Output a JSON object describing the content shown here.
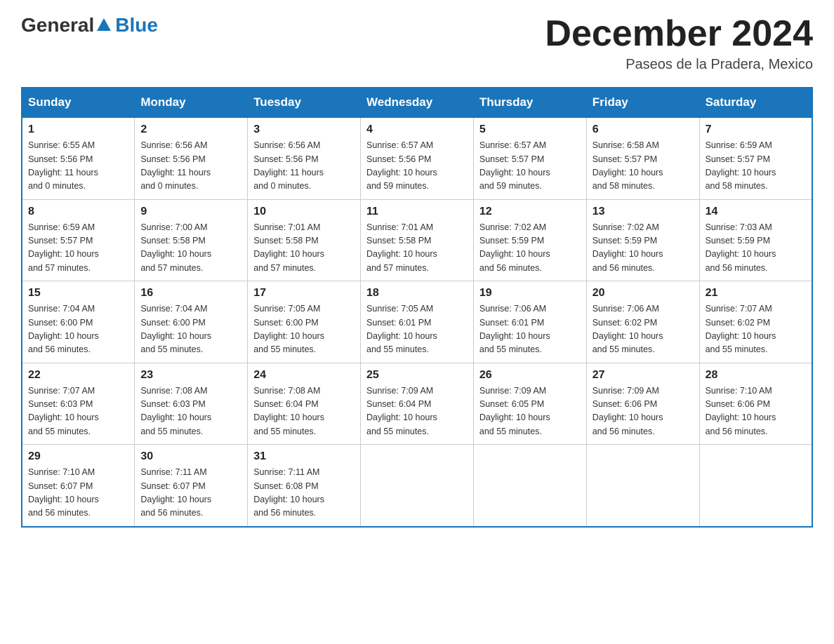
{
  "header": {
    "logo_general": "General",
    "logo_blue": "Blue",
    "month_title": "December 2024",
    "location": "Paseos de la Pradera, Mexico"
  },
  "days_of_week": [
    "Sunday",
    "Monday",
    "Tuesday",
    "Wednesday",
    "Thursday",
    "Friday",
    "Saturday"
  ],
  "weeks": [
    [
      {
        "day": "1",
        "info": "Sunrise: 6:55 AM\nSunset: 5:56 PM\nDaylight: 11 hours\nand 0 minutes."
      },
      {
        "day": "2",
        "info": "Sunrise: 6:56 AM\nSunset: 5:56 PM\nDaylight: 11 hours\nand 0 minutes."
      },
      {
        "day": "3",
        "info": "Sunrise: 6:56 AM\nSunset: 5:56 PM\nDaylight: 11 hours\nand 0 minutes."
      },
      {
        "day": "4",
        "info": "Sunrise: 6:57 AM\nSunset: 5:56 PM\nDaylight: 10 hours\nand 59 minutes."
      },
      {
        "day": "5",
        "info": "Sunrise: 6:57 AM\nSunset: 5:57 PM\nDaylight: 10 hours\nand 59 minutes."
      },
      {
        "day": "6",
        "info": "Sunrise: 6:58 AM\nSunset: 5:57 PM\nDaylight: 10 hours\nand 58 minutes."
      },
      {
        "day": "7",
        "info": "Sunrise: 6:59 AM\nSunset: 5:57 PM\nDaylight: 10 hours\nand 58 minutes."
      }
    ],
    [
      {
        "day": "8",
        "info": "Sunrise: 6:59 AM\nSunset: 5:57 PM\nDaylight: 10 hours\nand 57 minutes."
      },
      {
        "day": "9",
        "info": "Sunrise: 7:00 AM\nSunset: 5:58 PM\nDaylight: 10 hours\nand 57 minutes."
      },
      {
        "day": "10",
        "info": "Sunrise: 7:01 AM\nSunset: 5:58 PM\nDaylight: 10 hours\nand 57 minutes."
      },
      {
        "day": "11",
        "info": "Sunrise: 7:01 AM\nSunset: 5:58 PM\nDaylight: 10 hours\nand 57 minutes."
      },
      {
        "day": "12",
        "info": "Sunrise: 7:02 AM\nSunset: 5:59 PM\nDaylight: 10 hours\nand 56 minutes."
      },
      {
        "day": "13",
        "info": "Sunrise: 7:02 AM\nSunset: 5:59 PM\nDaylight: 10 hours\nand 56 minutes."
      },
      {
        "day": "14",
        "info": "Sunrise: 7:03 AM\nSunset: 5:59 PM\nDaylight: 10 hours\nand 56 minutes."
      }
    ],
    [
      {
        "day": "15",
        "info": "Sunrise: 7:04 AM\nSunset: 6:00 PM\nDaylight: 10 hours\nand 56 minutes."
      },
      {
        "day": "16",
        "info": "Sunrise: 7:04 AM\nSunset: 6:00 PM\nDaylight: 10 hours\nand 55 minutes."
      },
      {
        "day": "17",
        "info": "Sunrise: 7:05 AM\nSunset: 6:00 PM\nDaylight: 10 hours\nand 55 minutes."
      },
      {
        "day": "18",
        "info": "Sunrise: 7:05 AM\nSunset: 6:01 PM\nDaylight: 10 hours\nand 55 minutes."
      },
      {
        "day": "19",
        "info": "Sunrise: 7:06 AM\nSunset: 6:01 PM\nDaylight: 10 hours\nand 55 minutes."
      },
      {
        "day": "20",
        "info": "Sunrise: 7:06 AM\nSunset: 6:02 PM\nDaylight: 10 hours\nand 55 minutes."
      },
      {
        "day": "21",
        "info": "Sunrise: 7:07 AM\nSunset: 6:02 PM\nDaylight: 10 hours\nand 55 minutes."
      }
    ],
    [
      {
        "day": "22",
        "info": "Sunrise: 7:07 AM\nSunset: 6:03 PM\nDaylight: 10 hours\nand 55 minutes."
      },
      {
        "day": "23",
        "info": "Sunrise: 7:08 AM\nSunset: 6:03 PM\nDaylight: 10 hours\nand 55 minutes."
      },
      {
        "day": "24",
        "info": "Sunrise: 7:08 AM\nSunset: 6:04 PM\nDaylight: 10 hours\nand 55 minutes."
      },
      {
        "day": "25",
        "info": "Sunrise: 7:09 AM\nSunset: 6:04 PM\nDaylight: 10 hours\nand 55 minutes."
      },
      {
        "day": "26",
        "info": "Sunrise: 7:09 AM\nSunset: 6:05 PM\nDaylight: 10 hours\nand 55 minutes."
      },
      {
        "day": "27",
        "info": "Sunrise: 7:09 AM\nSunset: 6:06 PM\nDaylight: 10 hours\nand 56 minutes."
      },
      {
        "day": "28",
        "info": "Sunrise: 7:10 AM\nSunset: 6:06 PM\nDaylight: 10 hours\nand 56 minutes."
      }
    ],
    [
      {
        "day": "29",
        "info": "Sunrise: 7:10 AM\nSunset: 6:07 PM\nDaylight: 10 hours\nand 56 minutes."
      },
      {
        "day": "30",
        "info": "Sunrise: 7:11 AM\nSunset: 6:07 PM\nDaylight: 10 hours\nand 56 minutes."
      },
      {
        "day": "31",
        "info": "Sunrise: 7:11 AM\nSunset: 6:08 PM\nDaylight: 10 hours\nand 56 minutes."
      },
      {
        "day": "",
        "info": ""
      },
      {
        "day": "",
        "info": ""
      },
      {
        "day": "",
        "info": ""
      },
      {
        "day": "",
        "info": ""
      }
    ]
  ]
}
